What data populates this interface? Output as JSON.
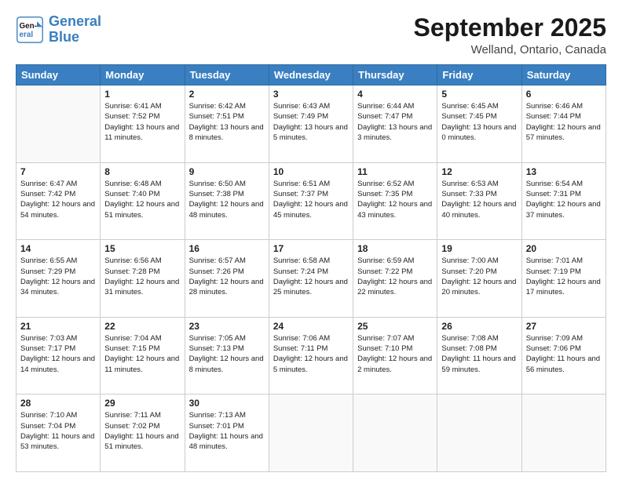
{
  "logo": {
    "line1": "General",
    "line2": "Blue"
  },
  "title": "September 2025",
  "subtitle": "Welland, Ontario, Canada",
  "days_of_week": [
    "Sunday",
    "Monday",
    "Tuesday",
    "Wednesday",
    "Thursday",
    "Friday",
    "Saturday"
  ],
  "weeks": [
    [
      {
        "day": "",
        "empty": true
      },
      {
        "day": "1",
        "sunrise": "6:41 AM",
        "sunset": "7:52 PM",
        "daylight": "13 hours and 11 minutes."
      },
      {
        "day": "2",
        "sunrise": "6:42 AM",
        "sunset": "7:51 PM",
        "daylight": "13 hours and 8 minutes."
      },
      {
        "day": "3",
        "sunrise": "6:43 AM",
        "sunset": "7:49 PM",
        "daylight": "13 hours and 5 minutes."
      },
      {
        "day": "4",
        "sunrise": "6:44 AM",
        "sunset": "7:47 PM",
        "daylight": "13 hours and 3 minutes."
      },
      {
        "day": "5",
        "sunrise": "6:45 AM",
        "sunset": "7:45 PM",
        "daylight": "13 hours and 0 minutes."
      },
      {
        "day": "6",
        "sunrise": "6:46 AM",
        "sunset": "7:44 PM",
        "daylight": "12 hours and 57 minutes."
      }
    ],
    [
      {
        "day": "7",
        "sunrise": "6:47 AM",
        "sunset": "7:42 PM",
        "daylight": "12 hours and 54 minutes."
      },
      {
        "day": "8",
        "sunrise": "6:48 AM",
        "sunset": "7:40 PM",
        "daylight": "12 hours and 51 minutes."
      },
      {
        "day": "9",
        "sunrise": "6:50 AM",
        "sunset": "7:38 PM",
        "daylight": "12 hours and 48 minutes."
      },
      {
        "day": "10",
        "sunrise": "6:51 AM",
        "sunset": "7:37 PM",
        "daylight": "12 hours and 45 minutes."
      },
      {
        "day": "11",
        "sunrise": "6:52 AM",
        "sunset": "7:35 PM",
        "daylight": "12 hours and 43 minutes."
      },
      {
        "day": "12",
        "sunrise": "6:53 AM",
        "sunset": "7:33 PM",
        "daylight": "12 hours and 40 minutes."
      },
      {
        "day": "13",
        "sunrise": "6:54 AM",
        "sunset": "7:31 PM",
        "daylight": "12 hours and 37 minutes."
      }
    ],
    [
      {
        "day": "14",
        "sunrise": "6:55 AM",
        "sunset": "7:29 PM",
        "daylight": "12 hours and 34 minutes."
      },
      {
        "day": "15",
        "sunrise": "6:56 AM",
        "sunset": "7:28 PM",
        "daylight": "12 hours and 31 minutes."
      },
      {
        "day": "16",
        "sunrise": "6:57 AM",
        "sunset": "7:26 PM",
        "daylight": "12 hours and 28 minutes."
      },
      {
        "day": "17",
        "sunrise": "6:58 AM",
        "sunset": "7:24 PM",
        "daylight": "12 hours and 25 minutes."
      },
      {
        "day": "18",
        "sunrise": "6:59 AM",
        "sunset": "7:22 PM",
        "daylight": "12 hours and 22 minutes."
      },
      {
        "day": "19",
        "sunrise": "7:00 AM",
        "sunset": "7:20 PM",
        "daylight": "12 hours and 20 minutes."
      },
      {
        "day": "20",
        "sunrise": "7:01 AM",
        "sunset": "7:19 PM",
        "daylight": "12 hours and 17 minutes."
      }
    ],
    [
      {
        "day": "21",
        "sunrise": "7:03 AM",
        "sunset": "7:17 PM",
        "daylight": "12 hours and 14 minutes."
      },
      {
        "day": "22",
        "sunrise": "7:04 AM",
        "sunset": "7:15 PM",
        "daylight": "12 hours and 11 minutes."
      },
      {
        "day": "23",
        "sunrise": "7:05 AM",
        "sunset": "7:13 PM",
        "daylight": "12 hours and 8 minutes."
      },
      {
        "day": "24",
        "sunrise": "7:06 AM",
        "sunset": "7:11 PM",
        "daylight": "12 hours and 5 minutes."
      },
      {
        "day": "25",
        "sunrise": "7:07 AM",
        "sunset": "7:10 PM",
        "daylight": "12 hours and 2 minutes."
      },
      {
        "day": "26",
        "sunrise": "7:08 AM",
        "sunset": "7:08 PM",
        "daylight": "11 hours and 59 minutes."
      },
      {
        "day": "27",
        "sunrise": "7:09 AM",
        "sunset": "7:06 PM",
        "daylight": "11 hours and 56 minutes."
      }
    ],
    [
      {
        "day": "28",
        "sunrise": "7:10 AM",
        "sunset": "7:04 PM",
        "daylight": "11 hours and 53 minutes."
      },
      {
        "day": "29",
        "sunrise": "7:11 AM",
        "sunset": "7:02 PM",
        "daylight": "11 hours and 51 minutes."
      },
      {
        "day": "30",
        "sunrise": "7:13 AM",
        "sunset": "7:01 PM",
        "daylight": "11 hours and 48 minutes."
      },
      {
        "day": "",
        "empty": true
      },
      {
        "day": "",
        "empty": true
      },
      {
        "day": "",
        "empty": true
      },
      {
        "day": "",
        "empty": true
      }
    ]
  ]
}
